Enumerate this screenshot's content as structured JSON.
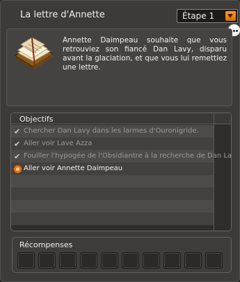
{
  "window": {
    "title": "La lettre d'Annette"
  },
  "step_select": {
    "value": "Étape 1"
  },
  "description": {
    "text": "Annette Daimpeau souhaite que vous retrouviez son fiancé Dan Lavy, disparu avant la glaciation, et que vous lui remettiez une lettre."
  },
  "objectives": {
    "title": "Objectifs",
    "items": [
      {
        "label": "Chercher Dan Lavy dans les larmes d'Ouronigride.",
        "status": "done"
      },
      {
        "label": "Aller voir Lave Azza",
        "status": "done"
      },
      {
        "label": "Fouiller l'hypogée de l'Obsidiantre à la recherche de Dan Lavy",
        "status": "done"
      },
      {
        "label": "Aller voir Annette Daimpeau",
        "status": "current"
      }
    ]
  },
  "rewards": {
    "title": "Récompenses",
    "slot_count": 10
  },
  "colors": {
    "accent": "#e27311",
    "background": "#3d3b39"
  },
  "icons": {
    "done": "check-icon",
    "current": "quest-marker-icon",
    "step_arrow": "chevron-down-icon",
    "chat": "chat-bubble-icon",
    "illustration": "book-icon"
  }
}
